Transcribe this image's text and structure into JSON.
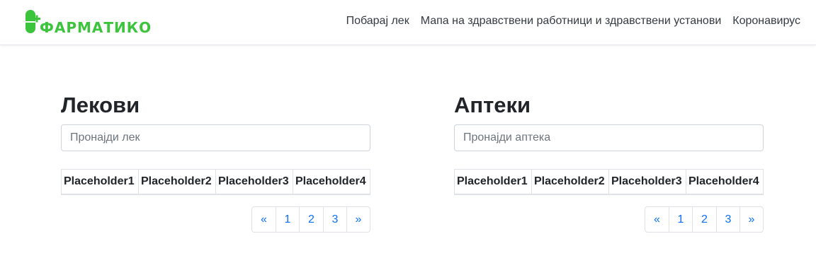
{
  "brand": {
    "name": "ФАРМАТИКО",
    "color": "#3cc43c",
    "icon": "pill-icon"
  },
  "nav": {
    "items": [
      "Побарај лек",
      "Мапа на здравствени работници и здравствени установи",
      "Коронавирус"
    ]
  },
  "medicines": {
    "title": "Лекови",
    "search_placeholder": "Пронајди лек",
    "columns": [
      "Placeholder1",
      "Placeholder2",
      "Placeholder3",
      "Placeholder4"
    ],
    "pagination": [
      "«",
      "1",
      "2",
      "3",
      "»"
    ]
  },
  "pharmacies": {
    "title": "Аптеки",
    "search_placeholder": "Пронајди аптека",
    "columns": [
      "Placeholder1",
      "Placeholder2",
      "Placeholder3",
      "Placeholder4"
    ],
    "pagination": [
      "«",
      "1",
      "2",
      "3",
      "»"
    ]
  },
  "colors": {
    "link": "#0d6efd",
    "text": "#212529",
    "border": "#dee2e6"
  }
}
